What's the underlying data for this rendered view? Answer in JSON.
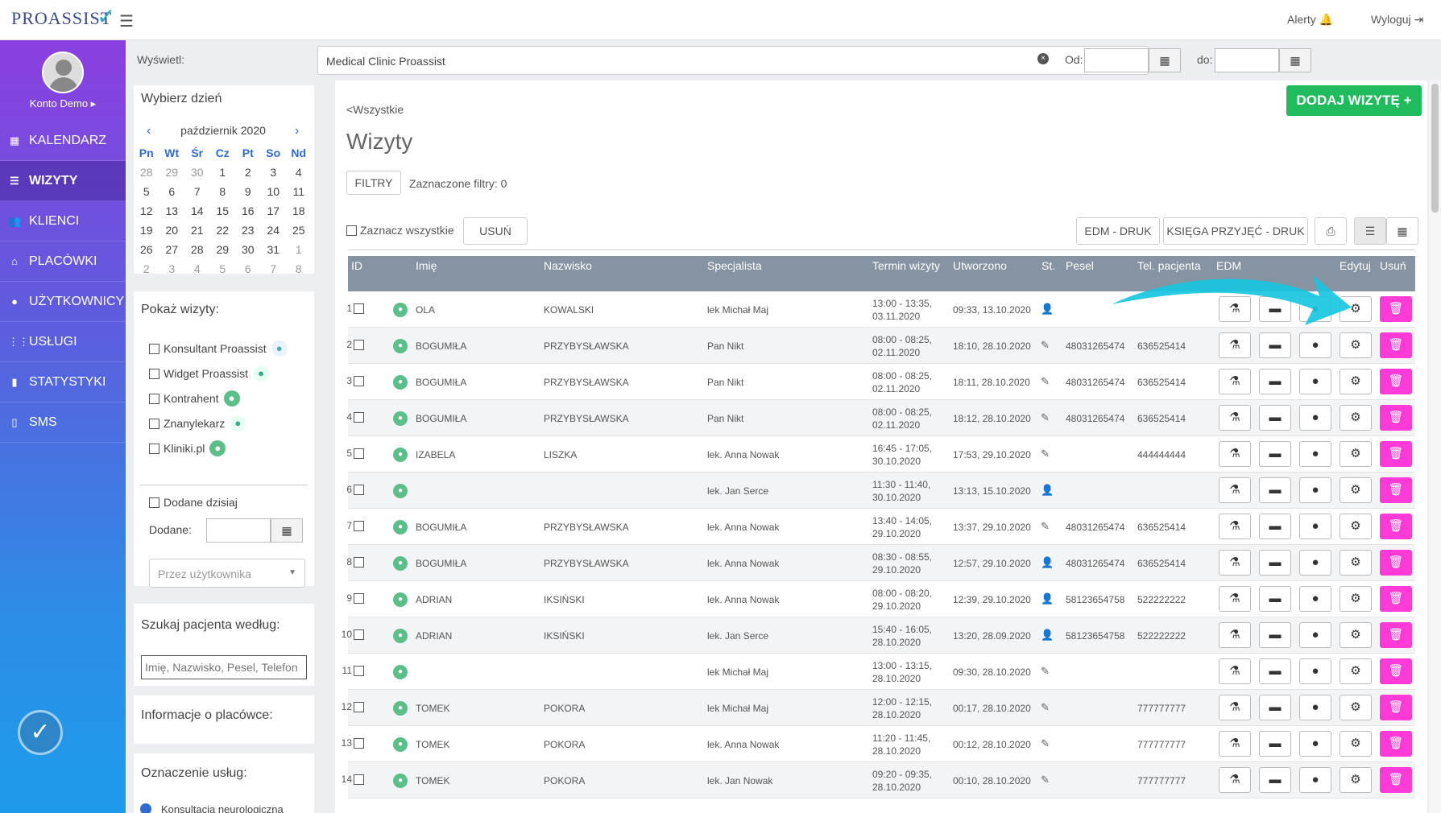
{
  "topbar": {
    "logo": "PROASSIST",
    "alerts": "Alerty",
    "logout": "Wyloguj"
  },
  "sidebar": {
    "account": "Konto Demo ▸",
    "items": [
      {
        "label": "KALENDARZ",
        "icon": "calendar-icon"
      },
      {
        "label": "WIZYTY",
        "icon": "list-icon"
      },
      {
        "label": "KLIENCI",
        "icon": "users-icon"
      },
      {
        "label": "PLACÓWKI",
        "icon": "building-icon"
      },
      {
        "label": "UŻYTKOWNICY",
        "icon": "user-icon"
      },
      {
        "label": "USŁUGI",
        "icon": "grid-icon"
      },
      {
        "label": "STATYSTYKI",
        "icon": "bar-chart-icon"
      },
      {
        "label": "SMS",
        "icon": "phone-icon"
      }
    ]
  },
  "filter": {
    "show_label": "Wyświetl:",
    "clinic": "Medical Clinic Proassist",
    "from_label": "Od:",
    "to_label": "do:"
  },
  "day_picker": {
    "title": "Wybierz dzień",
    "month": "październik 2020",
    "weekdays": [
      "Pn",
      "Wt",
      "Śr",
      "Cz",
      "Pt",
      "So",
      "Nd"
    ],
    "weeks": [
      [
        "28",
        "29",
        "30",
        "1",
        "2",
        "3",
        "4"
      ],
      [
        "5",
        "6",
        "7",
        "8",
        "9",
        "10",
        "11"
      ],
      [
        "12",
        "13",
        "14",
        "15",
        "16",
        "17",
        "18"
      ],
      [
        "19",
        "20",
        "21",
        "22",
        "23",
        "24",
        "25"
      ],
      [
        "26",
        "27",
        "28",
        "29",
        "30",
        "31",
        "1"
      ],
      [
        "2",
        "3",
        "4",
        "5",
        "6",
        "7",
        "8"
      ]
    ]
  },
  "show_visits": {
    "title": "Pokaż wizyty:",
    "sources": [
      "Konsultant Proassist",
      "Widget Proassist",
      "Kontrahent",
      "Znanylekarz",
      "Kliniki.pl"
    ],
    "added_today": "Dodane dzisiaj",
    "added_label": "Dodane:",
    "by_user_placeholder": "Przez użytkownika"
  },
  "search": {
    "title": "Szukaj pacjenta według:",
    "placeholder": "Imię, Nazwisko, Pesel, Telefon"
  },
  "info": {
    "title": "Informacje o placówce:"
  },
  "services": {
    "title": "Oznaczenie usług:",
    "first": "Konsultacja neurologiczna"
  },
  "main": {
    "back": "<Wszystkie",
    "title": "Wizyty",
    "filters_btn": "FILTRY",
    "filters_count": "Zaznaczone filtry: 0",
    "select_all": "Zaznacz wszystkie",
    "delete_btn": "USUŃ",
    "edm_btn": "EDM - DRUK",
    "book_btn": "KSIĘGA PRZYJĘĆ - DRUK",
    "add_btn": "DODAJ WIZYTĘ +"
  },
  "table": {
    "headers": {
      "id": "ID",
      "name": "Imię",
      "surname": "Nazwisko",
      "specialist": "Specjalista",
      "term": "Termin wizyty",
      "created": "Utworzono",
      "st": "St.",
      "pesel": "Pesel",
      "phone": "Tel. pacjenta",
      "edm": "EDM",
      "edit": "Edytuj",
      "delete": "Usuń"
    },
    "rows": [
      {
        "id": "1",
        "name": "OLA",
        "surname": "KOWALSKI",
        "specialist": "lek Michał Maj",
        "term1": "13:00 - 13:35,",
        "term2": "03.11.2020",
        "created": "09:33, 13.10.2020",
        "st": "👤",
        "pesel": "",
        "phone": ""
      },
      {
        "id": "2",
        "name": "BOGUMIŁA",
        "surname": "PRZYBYSŁAWSKA",
        "specialist": "Pan Nikt",
        "term1": "08:00 - 08:25,",
        "term2": "02.11.2020",
        "created": "18:10, 28.10.2020",
        "st": "✎",
        "pesel": "48031265474",
        "phone": "636525414"
      },
      {
        "id": "3",
        "name": "BOGUMIŁA",
        "surname": "PRZYBYSŁAWSKA",
        "specialist": "Pan Nikt",
        "term1": "08:00 - 08:25,",
        "term2": "02.11.2020",
        "created": "18:11, 28.10.2020",
        "st": "✎",
        "pesel": "48031265474",
        "phone": "636525414"
      },
      {
        "id": "4",
        "name": "BOGUMIŁA",
        "surname": "PRZYBYSŁAWSKA",
        "specialist": "Pan Nikt",
        "term1": "08:00 - 08:25,",
        "term2": "02.11.2020",
        "created": "18:12, 28.10.2020",
        "st": "✎",
        "pesel": "48031265474",
        "phone": "636525414"
      },
      {
        "id": "5",
        "name": "IZABELA",
        "surname": "LISZKA",
        "specialist": "lek. Anna Nowak",
        "term1": "16:45 - 17:05,",
        "term2": "30.10.2020",
        "created": "17:53, 29.10.2020",
        "st": "✎",
        "pesel": "",
        "phone": "444444444"
      },
      {
        "id": "6",
        "name": "",
        "surname": "",
        "specialist": "lek. Jan Serce",
        "term1": "11:30 - 11:40,",
        "term2": "30.10.2020",
        "created": "13:13, 15.10.2020",
        "st": "👤",
        "pesel": "",
        "phone": ""
      },
      {
        "id": "7",
        "name": "BOGUMIŁA",
        "surname": "PRZYBYSŁAWSKA",
        "specialist": "lek. Anna Nowak",
        "term1": "13:40 - 14:05,",
        "term2": "29.10.2020",
        "created": "13:37, 29.10.2020",
        "st": "✎",
        "pesel": "48031265474",
        "phone": "636525414"
      },
      {
        "id": "8",
        "name": "BOGUMIŁA",
        "surname": "PRZYBYSŁAWSKA",
        "specialist": "lek. Anna Nowak",
        "term1": "08:30 - 08:55,",
        "term2": "29.10.2020",
        "created": "12:57, 29.10.2020",
        "st": "👤",
        "pesel": "48031265474",
        "phone": "636525414"
      },
      {
        "id": "9",
        "name": "ADRIAN",
        "surname": "IKSIŃSKI",
        "specialist": "lek. Anna Nowak",
        "term1": "08:00 - 08:20,",
        "term2": "29.10.2020",
        "created": "12:39, 29.10.2020",
        "st": "👤",
        "pesel": "58123654758",
        "phone": "522222222"
      },
      {
        "id": "10",
        "name": "ADRIAN",
        "surname": "IKSIŃSKI",
        "specialist": "lek. Jan Serce",
        "term1": "15:40 - 16:05,",
        "term2": "28.10.2020",
        "created": "13:20, 28.09.2020",
        "st": "👤",
        "pesel": "58123654758",
        "phone": "522222222"
      },
      {
        "id": "11",
        "name": "",
        "surname": "",
        "specialist": "lek Michał Maj",
        "term1": "13:00 - 13:15,",
        "term2": "28.10.2020",
        "created": "09:30, 28.10.2020",
        "st": "✎",
        "pesel": "",
        "phone": ""
      },
      {
        "id": "12",
        "name": "TOMEK",
        "surname": "POKORA",
        "specialist": "lek Michał Maj",
        "term1": "12:00 - 12:15,",
        "term2": "28.10.2020",
        "created": "00:17, 28.10.2020",
        "st": "✎",
        "pesel": "",
        "phone": "777777777"
      },
      {
        "id": "13",
        "name": "TOMEK",
        "surname": "POKORA",
        "specialist": "lek. Anna Nowak",
        "term1": "11:20 - 11:45,",
        "term2": "28.10.2020",
        "created": "00:12, 28.10.2020",
        "st": "✎",
        "pesel": "",
        "phone": "777777777"
      },
      {
        "id": "14",
        "name": "TOMEK",
        "surname": "POKORA",
        "specialist": "lek. Jan Nowak",
        "term1": "09:20 - 09:35,",
        "term2": "28.10.2020",
        "created": "00:10, 28.10.2020",
        "st": "✎",
        "pesel": "",
        "phone": "777777777"
      }
    ]
  },
  "colors": {
    "accent_green": "#1fbb5c",
    "delete_pink": "#ff3ad6",
    "header_gray": "#8593a3"
  }
}
